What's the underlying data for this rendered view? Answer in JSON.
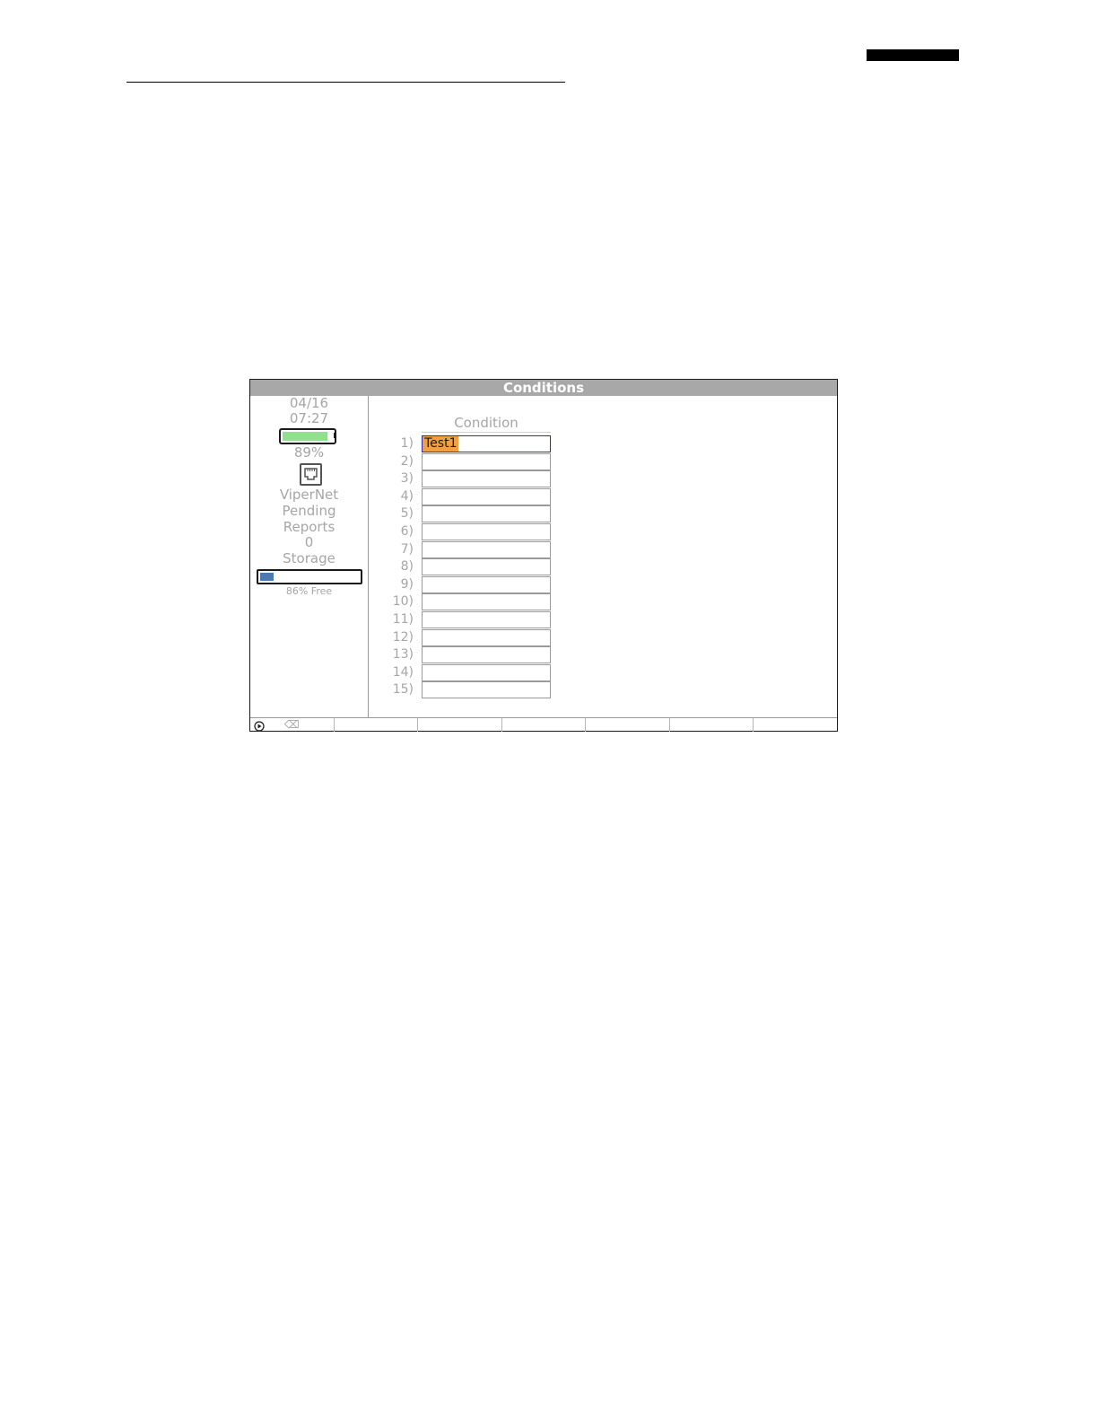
{
  "window": {
    "title": "Conditions"
  },
  "sidebar": {
    "date": "04/16",
    "time": "07:27",
    "battery_percent_label": "89%",
    "battery_level": 0.89,
    "battery_color": "#8fe08f",
    "network_icon": "ethernet-port-icon",
    "network_name": "ViperNet",
    "pending_label_1": "Pending",
    "pending_label_2": "Reports",
    "pending_count": "0",
    "storage_label": "Storage",
    "storage_used_fraction": 0.14,
    "storage_fill_color": "#4a7ab0",
    "storage_free_label": "86% Free",
    "play_icon": "play-circle-icon"
  },
  "conditions_table": {
    "column_header": "Condition",
    "selection_color": "#f0a040",
    "rows": [
      {
        "num": "1)",
        "value": "Test1"
      },
      {
        "num": "2)",
        "value": ""
      },
      {
        "num": "3)",
        "value": ""
      },
      {
        "num": "4)",
        "value": ""
      },
      {
        "num": "5)",
        "value": ""
      },
      {
        "num": "6)",
        "value": ""
      },
      {
        "num": "7)",
        "value": ""
      },
      {
        "num": "8)",
        "value": ""
      },
      {
        "num": "9)",
        "value": ""
      },
      {
        "num": "10)",
        "value": ""
      },
      {
        "num": "11)",
        "value": ""
      },
      {
        "num": "12)",
        "value": ""
      },
      {
        "num": "13)",
        "value": ""
      },
      {
        "num": "14)",
        "value": ""
      },
      {
        "num": "15)",
        "value": ""
      }
    ]
  },
  "softkeys": {
    "keys": [
      {
        "label": "⌫",
        "icon": "backspace-icon"
      },
      {
        "label": ""
      },
      {
        "label": ""
      },
      {
        "label": ""
      },
      {
        "label": ""
      },
      {
        "label": ""
      },
      {
        "label": ""
      }
    ]
  }
}
